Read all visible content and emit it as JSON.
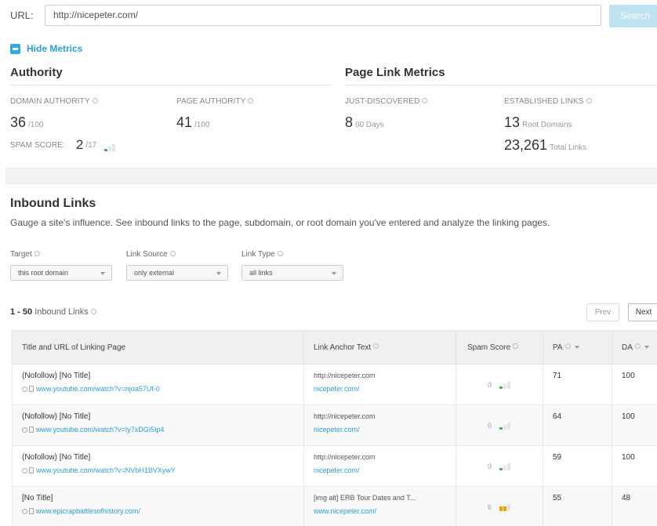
{
  "url_bar": {
    "label": "URL:",
    "value": "http://nicepeter.com/",
    "search_label": "Search"
  },
  "toggle": {
    "label": "Hide Metrics"
  },
  "authority": {
    "title": "Authority",
    "domain_authority_label": "DOMAIN AUTHORITY",
    "domain_authority_value": "36",
    "domain_authority_max": "/100",
    "page_authority_label": "PAGE AUTHORITY",
    "page_authority_value": "41",
    "page_authority_max": "/100",
    "spam_label": "SPAM SCORE:",
    "spam_value": "2",
    "spam_max": "/17"
  },
  "page_link_metrics": {
    "title": "Page Link Metrics",
    "just_discovered_label": "JUST-DISCOVERED",
    "just_discovered_value": "8",
    "just_discovered_unit": "60 Days",
    "established_label": "ESTABLISHED LINKS",
    "root_domains_value": "13",
    "root_domains_unit": "Root Domains",
    "total_links_value": "23,261",
    "total_links_unit": "Total Links"
  },
  "inbound": {
    "title": "Inbound Links",
    "description": "Gauge a site's influence. See inbound links to the page, subdomain, or root domain you've entered and analyze the linking pages.",
    "filters": {
      "target_label": "Target",
      "target_value": "this root domain",
      "source_label": "Link Source",
      "source_value": "only external",
      "type_label": "Link Type",
      "type_value": "all links"
    },
    "count_range": "1 - 50",
    "count_label": "Inbound Links",
    "prev_label": "Prev",
    "next_label": "Next",
    "columns": [
      "Title and URL of Linking Page",
      "Link Anchor Text",
      "Spam Score",
      "PA",
      "DA"
    ],
    "rows": [
      {
        "title": "(Nofollow) [No Title]",
        "url": "www.youtube.com/watch?v=njoa57Uf-0",
        "anchor_text": "http://nicepeter.com",
        "anchor_url": "nicepeter.com/",
        "spam": "0",
        "pa": "71",
        "da": "100"
      },
      {
        "title": "(Nofollow) [No Title]",
        "url": "www.youtube.com/watch?v=Iy7xDGi5Ip4",
        "anchor_text": "http://nicepeter.com",
        "anchor_url": "nicepeter.com/",
        "spam": "0",
        "pa": "64",
        "da": "100"
      },
      {
        "title": "(Nofollow) [No Title]",
        "url": "www.youtube.com/watch?v=NVbH1BVXywY",
        "anchor_text": "http://nicepeter.com",
        "anchor_url": "nicepeter.com/",
        "spam": "0",
        "pa": "59",
        "da": "100"
      },
      {
        "title": "[No Title]",
        "url": "www.epicrapbattlesofhistory.com/",
        "anchor_text": "[img alt] ERB Tour Dates and T...",
        "anchor_url": "www.nicepeter.com/",
        "spam": "6",
        "pa": "55",
        "da": "48"
      }
    ]
  },
  "colors": {
    "accent": "#2a9fd6",
    "search_button": "#bfe2f3",
    "spam_low": "#4caf50",
    "spam_mid": "#f39c12"
  }
}
